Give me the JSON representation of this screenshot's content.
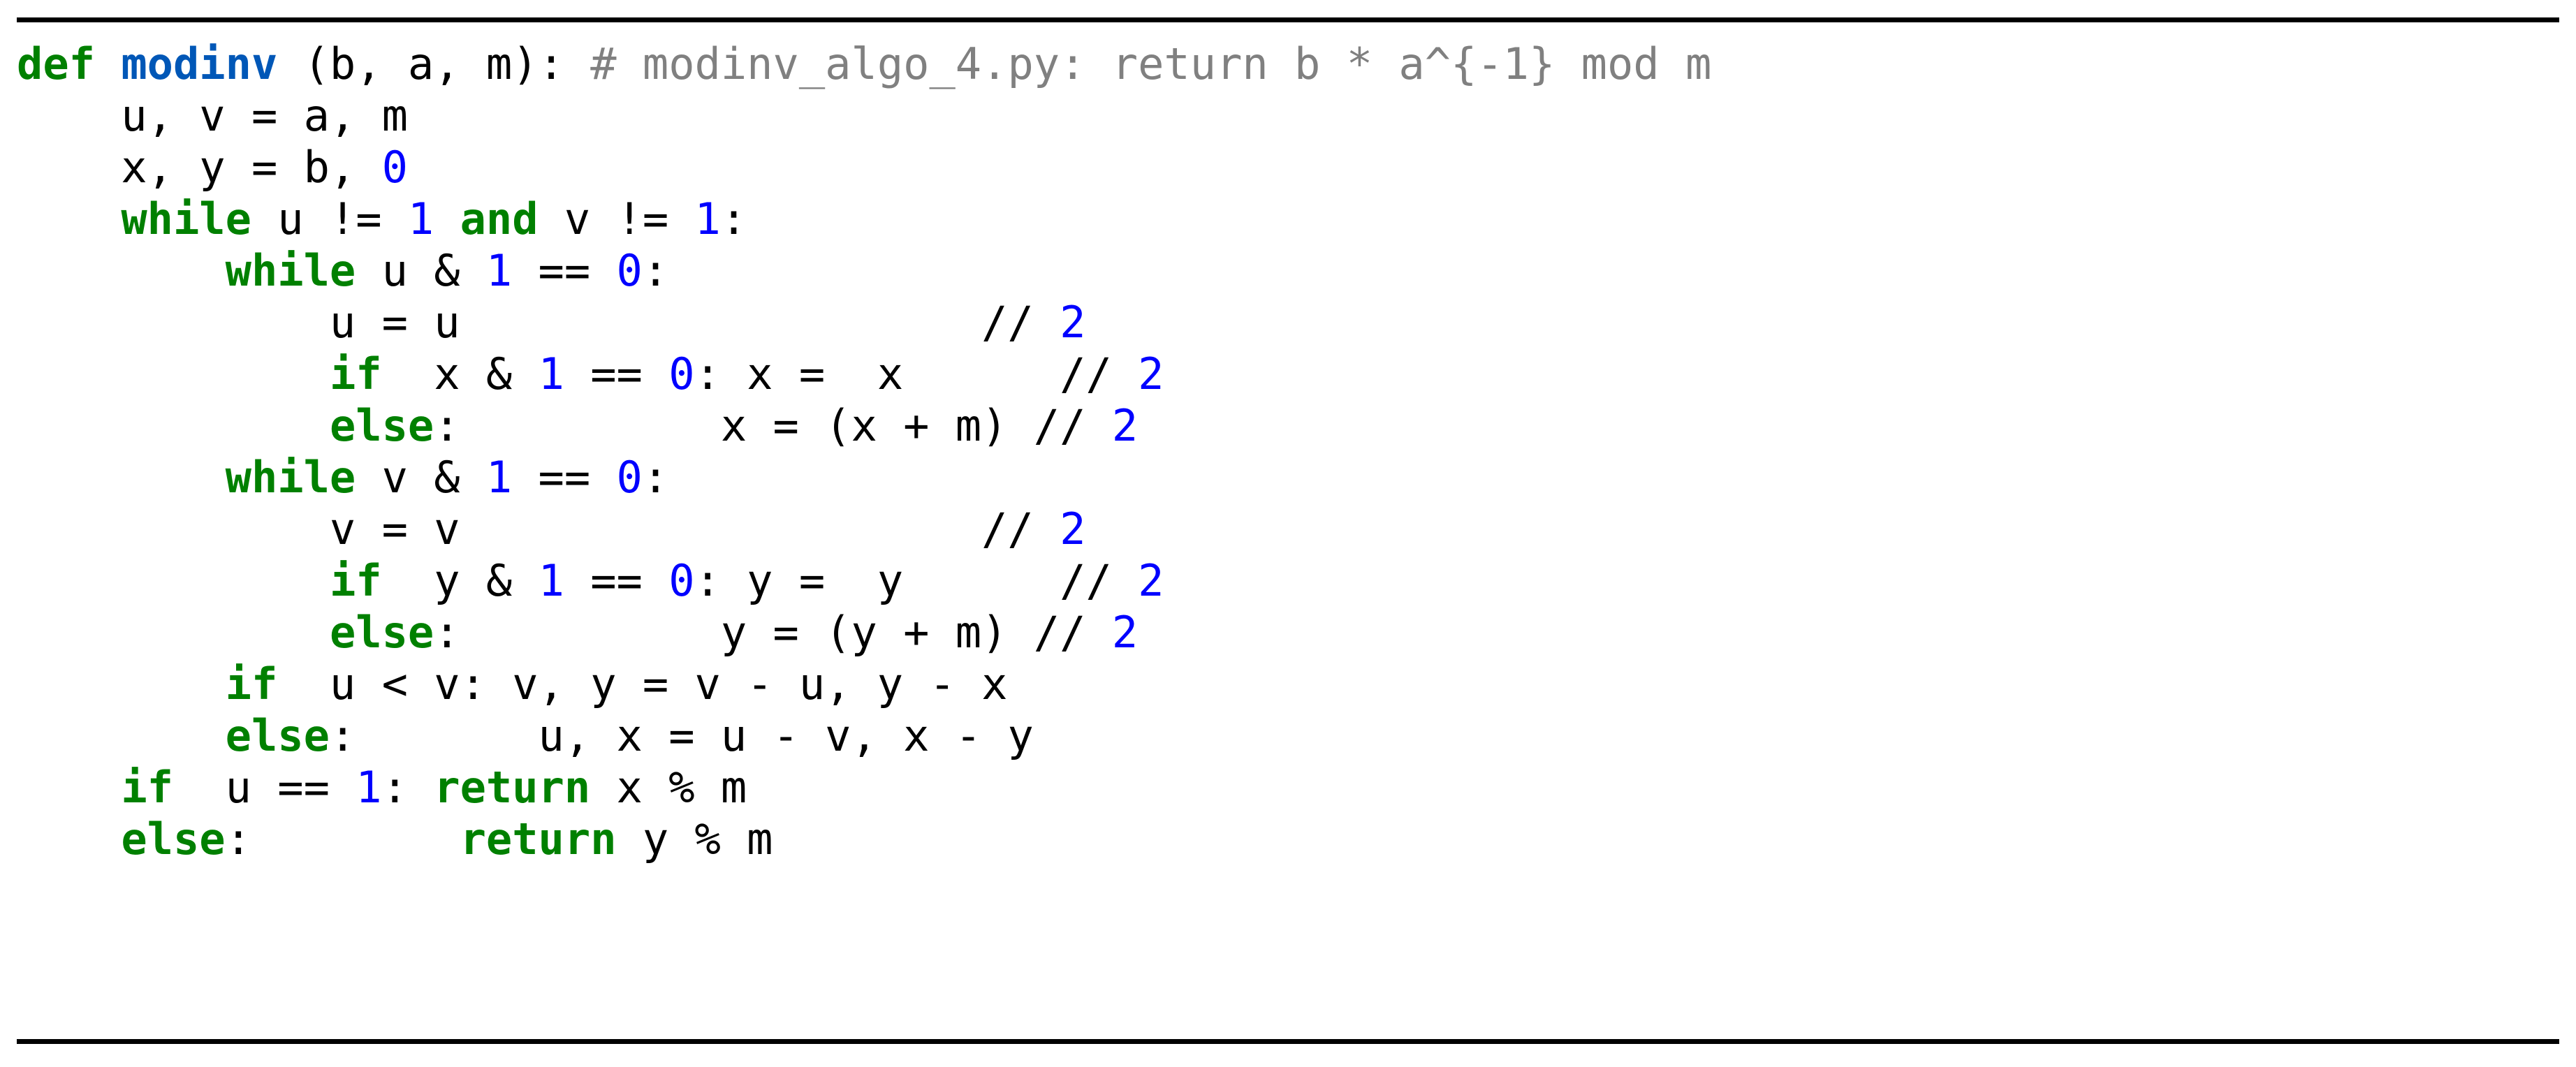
{
  "figure": {
    "kind": "code-listing",
    "language": "Python",
    "rule_color": "#000000",
    "background": "#ffffff"
  },
  "palette": {
    "plain": "#000000",
    "keyword": "#008000",
    "name": "#0057b7",
    "number": "#0000ff",
    "comment": "#808080",
    "punct": "#000000"
  },
  "code": {
    "lines": [
      {
        "id": "line-1-def",
        "tokens": [
          {
            "c": "keyword",
            "t": "def"
          },
          {
            "c": "plain",
            "t": " "
          },
          {
            "c": "name",
            "t": "modinv"
          },
          {
            "c": "plain",
            "t": " (b, a, m): "
          },
          {
            "c": "comment",
            "t": "# modinv_algo_4.py: return b * a^{-1} mod m"
          }
        ]
      },
      {
        "id": "line-2-uv-assign",
        "tokens": [
          {
            "c": "plain",
            "t": "    u, v = a, m"
          }
        ]
      },
      {
        "id": "line-3-xy-assign",
        "tokens": [
          {
            "c": "plain",
            "t": "    x, y = b, "
          },
          {
            "c": "number",
            "t": "0"
          }
        ]
      },
      {
        "id": "line-4-while-outer",
        "tokens": [
          {
            "c": "plain",
            "t": "    "
          },
          {
            "c": "keyword",
            "t": "while"
          },
          {
            "c": "plain",
            "t": " u != "
          },
          {
            "c": "number",
            "t": "1"
          },
          {
            "c": "plain",
            "t": " "
          },
          {
            "c": "keyword",
            "t": "and"
          },
          {
            "c": "plain",
            "t": " v != "
          },
          {
            "c": "number",
            "t": "1"
          },
          {
            "c": "plain",
            "t": ":"
          }
        ]
      },
      {
        "id": "line-5-while-u-even",
        "tokens": [
          {
            "c": "plain",
            "t": "        "
          },
          {
            "c": "keyword",
            "t": "while"
          },
          {
            "c": "plain",
            "t": " u & "
          },
          {
            "c": "number",
            "t": "1"
          },
          {
            "c": "plain",
            "t": " == "
          },
          {
            "c": "number",
            "t": "0"
          },
          {
            "c": "plain",
            "t": ":"
          }
        ]
      },
      {
        "id": "line-6-u-halve",
        "tokens": [
          {
            "c": "plain",
            "t": "            u = u                    // "
          },
          {
            "c": "number",
            "t": "2"
          }
        ]
      },
      {
        "id": "line-7-if-x-even",
        "tokens": [
          {
            "c": "plain",
            "t": "            "
          },
          {
            "c": "keyword",
            "t": "if"
          },
          {
            "c": "plain",
            "t": "  x & "
          },
          {
            "c": "number",
            "t": "1"
          },
          {
            "c": "plain",
            "t": " == "
          },
          {
            "c": "number",
            "t": "0"
          },
          {
            "c": "plain",
            "t": ": x =  x      // "
          },
          {
            "c": "number",
            "t": "2"
          }
        ]
      },
      {
        "id": "line-8-else-x",
        "tokens": [
          {
            "c": "plain",
            "t": "            "
          },
          {
            "c": "keyword",
            "t": "else"
          },
          {
            "c": "plain",
            "t": ":          x = (x + m) // "
          },
          {
            "c": "number",
            "t": "2"
          }
        ]
      },
      {
        "id": "line-9-while-v-even",
        "tokens": [
          {
            "c": "plain",
            "t": "        "
          },
          {
            "c": "keyword",
            "t": "while"
          },
          {
            "c": "plain",
            "t": " v & "
          },
          {
            "c": "number",
            "t": "1"
          },
          {
            "c": "plain",
            "t": " == "
          },
          {
            "c": "number",
            "t": "0"
          },
          {
            "c": "plain",
            "t": ":"
          }
        ]
      },
      {
        "id": "line-10-v-halve",
        "tokens": [
          {
            "c": "plain",
            "t": "            v = v                    // "
          },
          {
            "c": "number",
            "t": "2"
          }
        ]
      },
      {
        "id": "line-11-if-y-even",
        "tokens": [
          {
            "c": "plain",
            "t": "            "
          },
          {
            "c": "keyword",
            "t": "if"
          },
          {
            "c": "plain",
            "t": "  y & "
          },
          {
            "c": "number",
            "t": "1"
          },
          {
            "c": "plain",
            "t": " == "
          },
          {
            "c": "number",
            "t": "0"
          },
          {
            "c": "plain",
            "t": ": y =  y      // "
          },
          {
            "c": "number",
            "t": "2"
          }
        ]
      },
      {
        "id": "line-12-else-y",
        "tokens": [
          {
            "c": "plain",
            "t": "            "
          },
          {
            "c": "keyword",
            "t": "else"
          },
          {
            "c": "plain",
            "t": ":          y = (y + m) // "
          },
          {
            "c": "number",
            "t": "2"
          }
        ]
      },
      {
        "id": "line-13-if-u-lt-v",
        "tokens": [
          {
            "c": "plain",
            "t": "        "
          },
          {
            "c": "keyword",
            "t": "if"
          },
          {
            "c": "plain",
            "t": "  u < v: v, y = v - u, y - x"
          }
        ]
      },
      {
        "id": "line-14-else-swap",
        "tokens": [
          {
            "c": "plain",
            "t": "        "
          },
          {
            "c": "keyword",
            "t": "else"
          },
          {
            "c": "plain",
            "t": ":       u, x = u - v, x - y"
          }
        ]
      },
      {
        "id": "line-15-if-u-eq-1",
        "tokens": [
          {
            "c": "plain",
            "t": "    "
          },
          {
            "c": "keyword",
            "t": "if"
          },
          {
            "c": "plain",
            "t": "  u == "
          },
          {
            "c": "number",
            "t": "1"
          },
          {
            "c": "plain",
            "t": ": "
          },
          {
            "c": "keyword",
            "t": "return"
          },
          {
            "c": "plain",
            "t": " x % m"
          }
        ]
      },
      {
        "id": "line-16-else-return-y",
        "tokens": [
          {
            "c": "plain",
            "t": "    "
          },
          {
            "c": "keyword",
            "t": "else"
          },
          {
            "c": "plain",
            "t": ":        "
          },
          {
            "c": "keyword",
            "t": "return"
          },
          {
            "c": "plain",
            "t": " y % m"
          }
        ]
      }
    ],
    "plain_text": "def modinv (b, a, m): # modinv_algo_4.py: return b * a^{-1} mod m\n    u, v = a, m\n    x, y = b, 0\n    while u != 1 and v != 1:\n        while u & 1 == 0:\n            u = u                    // 2\n            if  x & 1 == 0: x =  x      // 2\n            else:          x = (x + m) // 2\n        while v & 1 == 0:\n            v = v                    // 2\n            if  y & 1 == 0: y =  y      // 2\n            else:          y = (y + m) // 2\n        if  u < v: v, y = v - u, y - x\n        else:       u, x = u - v, x - y\n    if  u == 1: return x % m\n    else:        return y % m"
  }
}
